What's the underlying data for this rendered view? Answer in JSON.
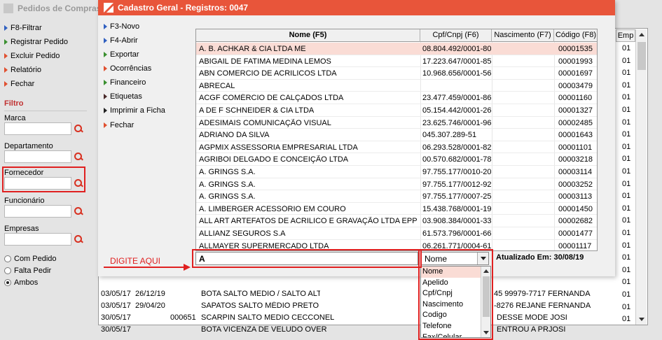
{
  "background_window": {
    "title": "Pedidos de Compras",
    "sidebar": [
      {
        "label": "F8-Filtrar",
        "color": "blue"
      },
      {
        "label": "Registrar Pedido",
        "color": "green"
      },
      {
        "label": "Excluir Pedido",
        "color": "red"
      },
      {
        "label": "Relatório",
        "color": "red"
      },
      {
        "label": "Fechar",
        "color": "red"
      }
    ],
    "filter": {
      "title": "Filtro",
      "fields": [
        "Marca",
        "Departamento",
        "Fornecedor",
        "Funcionário",
        "Empresas"
      ],
      "radios": [
        {
          "label": "Com Pedido",
          "checked": false
        },
        {
          "label": "Falta Pedir",
          "checked": false
        },
        {
          "label": "Ambos",
          "checked": true
        }
      ]
    },
    "grid": {
      "emp_header": "Emp",
      "emp_values": [
        "01",
        "01",
        "01",
        "01",
        "01",
        "01",
        "01",
        "01",
        "01",
        "01",
        "01",
        "01",
        "01",
        "01",
        "01",
        "01",
        "01",
        "01",
        "01",
        "01",
        "01",
        "01",
        "01"
      ],
      "rows": [
        {
          "c1": "03/05/17",
          "c2": "26/12/19",
          "c3": "",
          "c4": "BOTA SALTO MEDIO / SALTO ALTO",
          "c5": "45 99979-7717 FERNANDA"
        },
        {
          "c1": "03/05/17",
          "c2": "29/04/20",
          "c3": "",
          "c4": "SAPATOS SALTO MÉDIO PRETO E E",
          "c5": "-8276 REJANE  FERNANDA"
        },
        {
          "c1": "30/05/17",
          "c2": "",
          "c3": "000651",
          "c4": "SCARPIN SALTO MEDIO CECCONEL NUDE",
          "c5": "DESSE MODE JOSI"
        },
        {
          "c1": "30/05/17",
          "c2": "",
          "c3": "",
          "c4": "BOTA VICENZA DE VELUDO OVER",
          "c5": "ENTROU A PRJOSI"
        }
      ]
    }
  },
  "dialog": {
    "title": "Cadastro Geral - Registros: 0047",
    "sidebar": [
      {
        "label": "F3-Novo",
        "color": "blue"
      },
      {
        "label": "F4-Abrir",
        "color": "blue"
      },
      {
        "label": "Exportar",
        "color": "green"
      },
      {
        "label": "Ocorrências",
        "color": "red"
      },
      {
        "label": "Financeiro",
        "color": "green"
      },
      {
        "label": "Etiquetas",
        "color": "dark"
      },
      {
        "label": "Imprimir a Ficha",
        "color": "black"
      },
      {
        "label": "Fechar",
        "color": "red"
      }
    ],
    "columns": [
      "Nome (F5)",
      "Cpf/Cnpj (F6)",
      "Nascimento (F7)",
      "Código (F8)"
    ],
    "rows": [
      {
        "nome": "A. B. ACHKAR & CIA LTDA ME",
        "cpf": "08.804.492/0001-80",
        "nasc": "",
        "codigo": "00001535"
      },
      {
        "nome": "ABIGAIL DE FATIMA MEDINA LEMOS",
        "cpf": "17.223.647/0001-85",
        "nasc": "",
        "codigo": "00001993"
      },
      {
        "nome": "ABN COMERCIO DE ACRILICOS LTDA",
        "cpf": "10.968.656/0001-56",
        "nasc": "",
        "codigo": "00001697"
      },
      {
        "nome": "ABRECAL",
        "cpf": "",
        "nasc": "",
        "codigo": "00003479"
      },
      {
        "nome": "ACGF COMÉRCIO DE CALÇADOS LTDA",
        "cpf": "23.477.459/0001-86",
        "nasc": "",
        "codigo": "00001160"
      },
      {
        "nome": "A DE F SCHNEIDER & CIA LTDA",
        "cpf": "05.154.442/0001-26",
        "nasc": "",
        "codigo": "00001327"
      },
      {
        "nome": "ADESIMAIS COMUNICAÇÃO VISUAL",
        "cpf": "23.625.746/0001-96",
        "nasc": "",
        "codigo": "00002485"
      },
      {
        "nome": "ADRIANO DA SILVA",
        "cpf": "045.307.289-51",
        "nasc": "",
        "codigo": "00001643"
      },
      {
        "nome": "AGPMIX ASSESSORIA EMPRESARIAL LTDA",
        "cpf": "06.293.528/0001-82",
        "nasc": "",
        "codigo": "00001101"
      },
      {
        "nome": "AGRIBOI DELGADO E CONCEIÇÃO LTDA",
        "cpf": "00.570.682/0001-78",
        "nasc": "",
        "codigo": "00003218"
      },
      {
        "nome": "A. GRINGS S.A.",
        "cpf": "97.755.177/0010-20",
        "nasc": "",
        "codigo": "00003114"
      },
      {
        "nome": "A. GRINGS S.A.",
        "cpf": "97.755.177/0012-92",
        "nasc": "",
        "codigo": "00003252"
      },
      {
        "nome": "A. GRINGS S.A.",
        "cpf": "97.755.177/0007-25",
        "nasc": "",
        "codigo": "00003113"
      },
      {
        "nome": "A. LIMBERGER ACESSÓRIO EM COURO",
        "cpf": "15.438.768/0001-19",
        "nasc": "",
        "codigo": "00001450"
      },
      {
        "nome": "ALL ART ARTEFATOS DE ACRILICO E GRAVAÇÃO LTDA EPP",
        "cpf": "03.908.384/0001-33",
        "nasc": "",
        "codigo": "00002682"
      },
      {
        "nome": "ALLIANZ SEGUROS S.A",
        "cpf": "61.573.796/0001-66",
        "nasc": "",
        "codigo": "00001477"
      },
      {
        "nome": "ALLMAYER SUPERMERCADO LTDA",
        "cpf": "06.261.771/0004-61",
        "nasc": "",
        "codigo": "00001117"
      }
    ],
    "search": {
      "value": "A"
    },
    "combo": {
      "selected": "Nome"
    },
    "updated": "Atualizado Em: 30/08/19",
    "dropdown": [
      "Nome",
      "Apelido",
      "Cpf/Cnpj",
      "Nascimento",
      "Codigo",
      "Telefone",
      "Fax/Celular"
    ]
  },
  "annotation": {
    "text": "DIGITE AQUI"
  },
  "colors": {
    "accent": "#e8553a",
    "selection": "#fadcd5",
    "annotation": "#e02020"
  }
}
